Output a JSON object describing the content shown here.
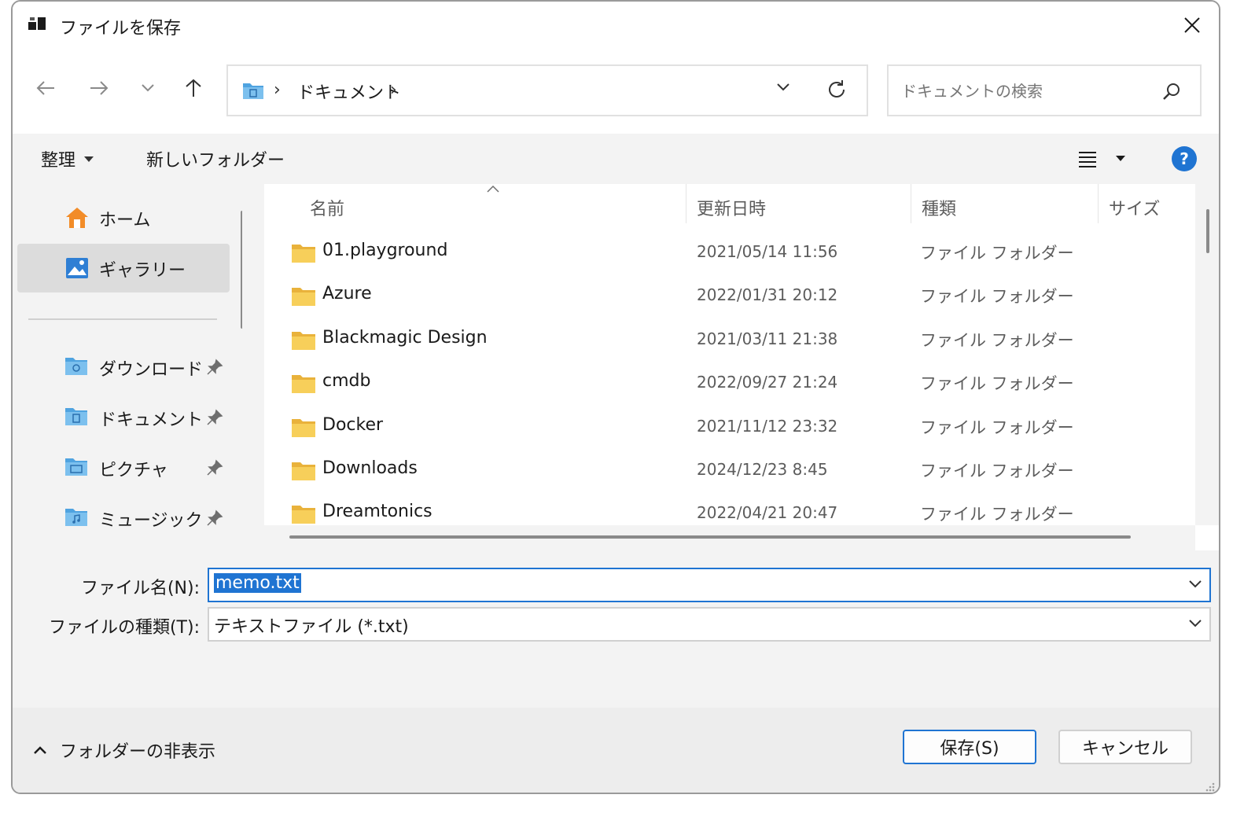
{
  "window": {
    "title": "ファイルを保存"
  },
  "address": {
    "crumbs": [
      "ドキュメント"
    ]
  },
  "search": {
    "placeholder": "ドキュメントの検索"
  },
  "toolbar": {
    "organize": "整理",
    "new_folder": "新しいフォルダー"
  },
  "sidebar": {
    "top_items": [
      {
        "label": "ホーム",
        "icon": "home-icon"
      },
      {
        "label": "ギャラリー",
        "icon": "gallery-icon",
        "selected": true
      }
    ],
    "quick_access": [
      {
        "label": "ダウンロード",
        "icon": "downloads-folder-icon",
        "pinned": true
      },
      {
        "label": "ドキュメント",
        "icon": "documents-folder-icon",
        "pinned": true
      },
      {
        "label": "ピクチャ",
        "icon": "pictures-folder-icon",
        "pinned": true
      },
      {
        "label": "ミュージック",
        "icon": "music-folder-icon",
        "pinned": true
      }
    ]
  },
  "file_list": {
    "columns": {
      "name": "名前",
      "date": "更新日時",
      "type": "種類",
      "size": "サイズ"
    },
    "rows": [
      {
        "name": "01.playground",
        "date": "2021/05/14 11:56",
        "type": "ファイル フォルダー"
      },
      {
        "name": "Azure",
        "date": "2022/01/31 20:12",
        "type": "ファイル フォルダー"
      },
      {
        "name": "Blackmagic Design",
        "date": "2021/03/11 21:38",
        "type": "ファイル フォルダー"
      },
      {
        "name": "cmdb",
        "date": "2022/09/27 21:24",
        "type": "ファイル フォルダー"
      },
      {
        "name": "Docker",
        "date": "2021/11/12 23:32",
        "type": "ファイル フォルダー"
      },
      {
        "name": "Downloads",
        "date": "2024/12/23 8:45",
        "type": "ファイル フォルダー"
      },
      {
        "name": "Dreamtonics",
        "date": "2022/04/21 20:47",
        "type": "ファイル フォルダー"
      }
    ]
  },
  "form": {
    "filename_label": "ファイル名(N):",
    "filename_value": "memo.txt",
    "filetype_label": "ファイルの種類(T):",
    "filetype_value": "テキストファイル (*.txt)"
  },
  "footer": {
    "hide_folders": "フォルダーの非表示",
    "save": "保存(S)",
    "cancel": "キャンセル"
  },
  "colors": {
    "accent": "#1f74d2",
    "folder": "#f4c64a",
    "panel": "#f3f3f3"
  }
}
